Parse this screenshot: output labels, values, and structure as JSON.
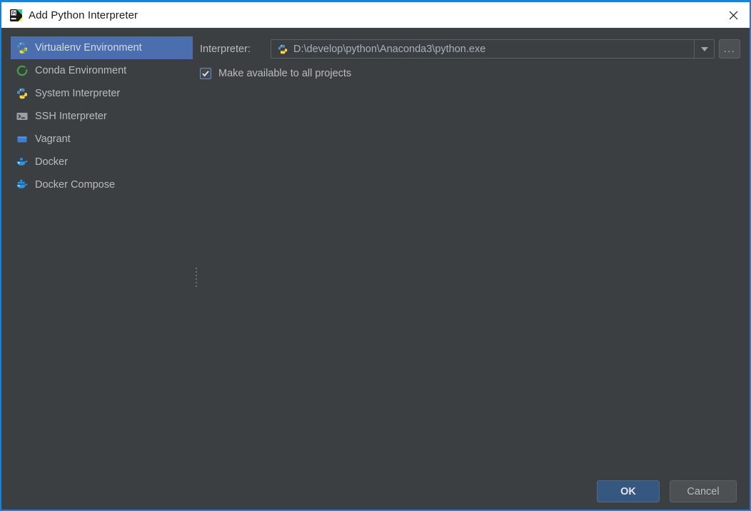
{
  "window": {
    "title": "Add Python Interpreter",
    "app_icon": "pycharm-icon",
    "close_icon": "close-icon",
    "frame_color": "#1683d8",
    "background": "#3c3f41",
    "titlebar_background": "#ffffff"
  },
  "sidebar": {
    "selected_index": 0,
    "selection_color": "#4b6eaf",
    "items": [
      {
        "label": "Virtualenv Environment",
        "icon": "virtualenv-python-icon"
      },
      {
        "label": "Conda Environment",
        "icon": "conda-ring-icon"
      },
      {
        "label": "System Interpreter",
        "icon": "python-icon"
      },
      {
        "label": "SSH Interpreter",
        "icon": "ssh-terminal-icon"
      },
      {
        "label": "Vagrant",
        "icon": "vagrant-cube-icon"
      },
      {
        "label": "Docker",
        "icon": "docker-whale-icon"
      },
      {
        "label": "Docker Compose",
        "icon": "docker-compose-whale-icon"
      }
    ]
  },
  "splitter": {
    "icon": "splitter-grip-icon"
  },
  "main": {
    "interpreter": {
      "label": "Interpreter:",
      "value": "D:\\develop\\python\\Anaconda3\\python.exe",
      "value_icon": "python-icon",
      "dropdown_icon": "chevron-down-icon",
      "browse_label": "...",
      "browse_title": "browse-button"
    },
    "make_available": {
      "label": "Make available to all projects",
      "checked": true,
      "check_icon": "checkmark-icon"
    }
  },
  "footer": {
    "ok_label": "OK",
    "cancel_label": "Cancel",
    "ok_color": "#365880"
  }
}
